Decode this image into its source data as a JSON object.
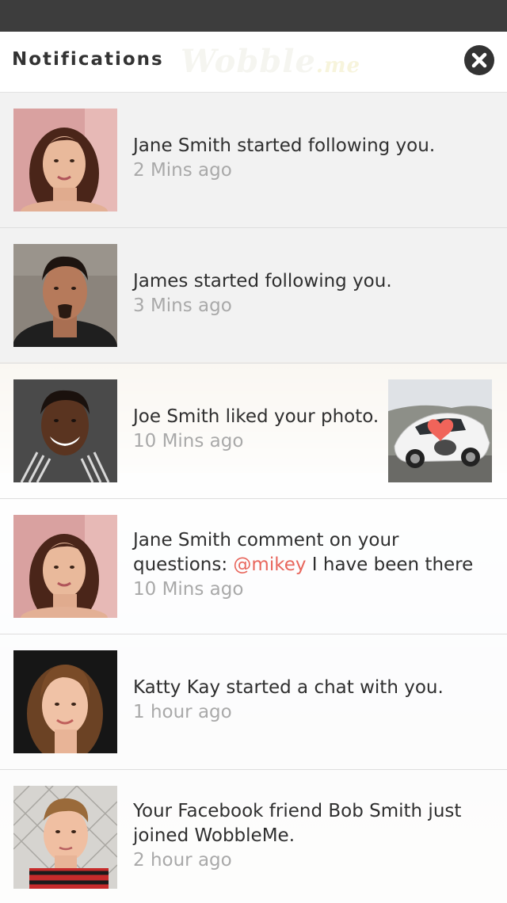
{
  "header": {
    "title": "Notifications",
    "watermark_logo": "Wobble.me"
  },
  "notifications": [
    {
      "message": "Jane Smith started following you.",
      "time": "2 Mins ago"
    },
    {
      "message": "James started following you.",
      "time": "3 Mins ago"
    },
    {
      "message": "Joe Smith liked your photo.",
      "time": "10 Mins ago"
    },
    {
      "message_before": "Jane Smith comment on your questions: ",
      "mention": "@mikey",
      "message_after": " I have been there",
      "time": "10 Mins ago"
    },
    {
      "message": "Katty Kay started a chat with you.",
      "time": "1 hour ago"
    },
    {
      "message": "Your Facebook friend Bob Smith just joined WobbleMe.",
      "time": "2 hour ago"
    }
  ],
  "colors": {
    "status_bar": "#3d3d3d",
    "mention": "#e8665c",
    "time_text": "#a9a9a9",
    "message_text": "#2f2f2f"
  },
  "icons": [
    "close-icon",
    "heart-icon"
  ]
}
